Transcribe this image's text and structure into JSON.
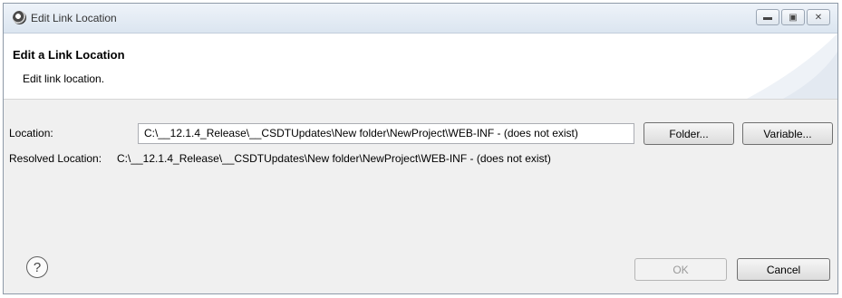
{
  "window": {
    "title": "Edit Link Location",
    "controls": {
      "minimize_icon": "minimize-icon",
      "maximize_icon": "maximize-icon",
      "close_icon": "close-icon"
    }
  },
  "header": {
    "title": "Edit a Link Location",
    "description": "Edit link location."
  },
  "location": {
    "label": "Location:",
    "value": "C:\\__12.1.4_Release\\__CSDTUpdates\\New folder\\NewProject\\WEB-INF - (does not exist)",
    "folder_button": "Folder...",
    "variable_button": "Variable..."
  },
  "resolved": {
    "label": "Resolved Location:",
    "value": "C:\\__12.1.4_Release\\__CSDTUpdates\\New folder\\NewProject\\WEB-INF - (does not exist)"
  },
  "footer": {
    "help_icon": "?",
    "ok_label": "OK",
    "cancel_label": "Cancel"
  },
  "colors": {
    "titlebar": "#dbe5f0",
    "dialog_bg": "#f0f0f0",
    "header_bg": "#ffffff"
  }
}
